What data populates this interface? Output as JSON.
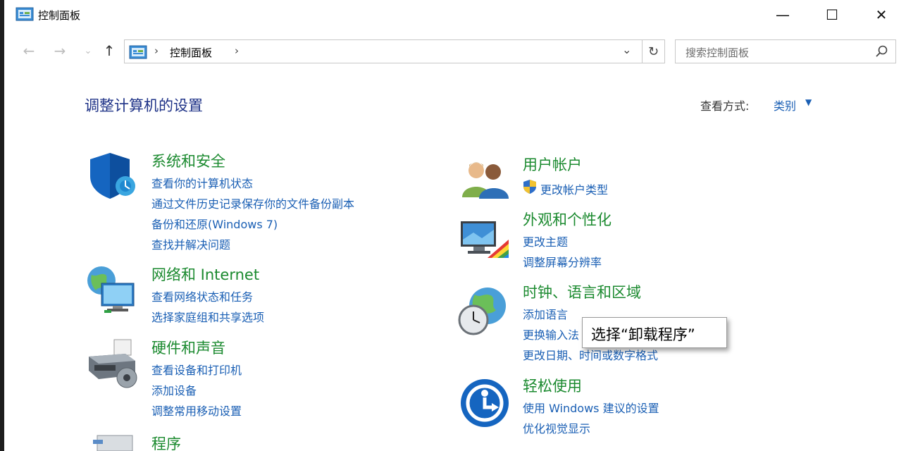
{
  "window": {
    "title": "控制面板",
    "minimize_glyph": "—",
    "maximize_glyph": "☐",
    "close_glyph": "✕"
  },
  "nav": {
    "back_glyph": "←",
    "forward_glyph": "→",
    "recent_glyph": "⌄",
    "up_glyph": "↑",
    "breadcrumb": "控制面板",
    "separator": "›",
    "dropdown_glyph": "⌄",
    "refresh_glyph": "↻",
    "search_placeholder": "搜索控制面板"
  },
  "header": {
    "title": "调整计算机的设置",
    "view_label": "查看方式:",
    "view_value": "类别",
    "view_caret": "▼"
  },
  "categories": {
    "system": {
      "title": "系统和安全",
      "links": [
        "查看你的计算机状态",
        "通过文件历史记录保存你的文件备份副本",
        "备份和还原(Windows 7)",
        "查找并解决问题"
      ],
      "icon": "shield-icon"
    },
    "network": {
      "title": "网络和 Internet",
      "links": [
        "查看网络状态和任务",
        "选择家庭组和共享选项"
      ],
      "icon": "network-globe-icon"
    },
    "hardware": {
      "title": "硬件和声音",
      "links": [
        "查看设备和打印机",
        "添加设备",
        "调整常用移动设置"
      ],
      "icon": "printer-icon"
    },
    "programs": {
      "title": "程序",
      "icon": "programs-icon"
    },
    "users": {
      "title": "用户帐户",
      "links": [
        "更改帐户类型"
      ],
      "icon": "users-icon"
    },
    "appearance": {
      "title": "外观和个性化",
      "links": [
        "更改主题",
        "调整屏幕分辨率"
      ],
      "icon": "monitor-palette-icon"
    },
    "clock": {
      "title": "时钟、语言和区域",
      "links": [
        "添加语言",
        "更换输入法",
        "更改日期、时间或数字格式"
      ],
      "icon": "clock-globe-icon"
    },
    "ease": {
      "title": "轻松使用",
      "links": [
        "使用 Windows 建议的设置",
        "优化视觉显示"
      ],
      "icon": "ease-of-access-icon"
    }
  },
  "tooltip": {
    "text": "选择“卸载程序”"
  },
  "colors": {
    "category_title": "#1b8a2f",
    "link": "#1a5fb4",
    "page_title": "#1e3287"
  }
}
